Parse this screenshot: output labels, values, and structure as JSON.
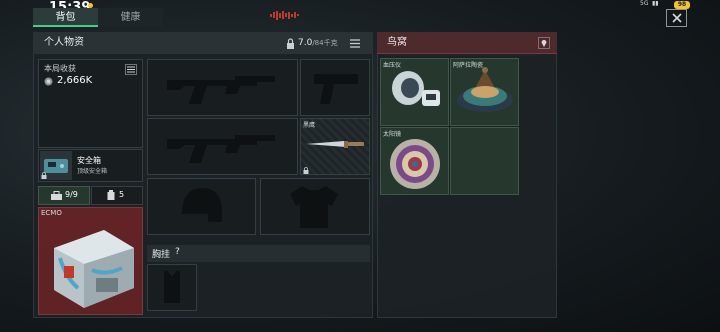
{
  "status_bar": {
    "time": "15:39",
    "network": "5G",
    "battery": "98"
  },
  "tabs": [
    {
      "label": "背包",
      "active": true
    },
    {
      "label": "健康",
      "active": false
    }
  ],
  "personal": {
    "title": "个人物资",
    "weight": "7.0",
    "weight_max": "/84千克",
    "earnings_label": "本局收获",
    "earnings_value": "2,666K",
    "safebox_name": "安全箱",
    "safebox_sub": "顶级安全箱",
    "count_a": "9/9",
    "count_b": "5",
    "ecmo_label": "ECMO"
  },
  "slots": {
    "knife_label": "黑鹰",
    "chest_label": "胸挂",
    "chest_help": "?"
  },
  "loot": {
    "title": "鸟窝",
    "items": [
      {
        "label": "血压仪"
      },
      {
        "label": "阿萨拉陶瓷"
      },
      {
        "label": "太阳镜"
      }
    ]
  },
  "colors": {
    "accent_green": "#3fd08a",
    "loot_header": "#5a2a2c",
    "wave_red": "#c0392b"
  }
}
